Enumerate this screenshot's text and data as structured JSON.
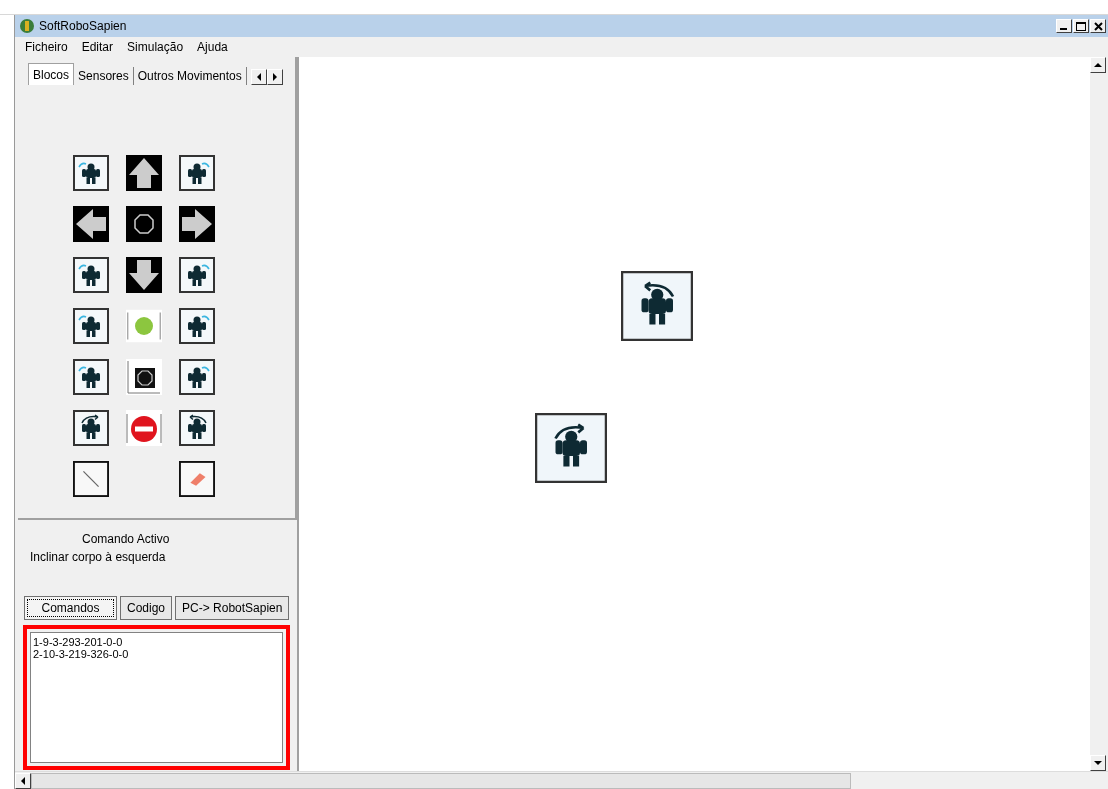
{
  "window": {
    "title": "SoftRoboSapien"
  },
  "menu": [
    "Ficheiro",
    "Editar",
    "Simulação",
    "Ajuda"
  ],
  "palette_tabs": [
    {
      "label": "Blocos",
      "selected": true
    },
    {
      "label": "Sensores",
      "selected": false
    },
    {
      "label": "Outros Movimentos",
      "selected": false
    }
  ],
  "blocks": [
    [
      {
        "kind": "robot"
      },
      {
        "kind": "arrow-up"
      },
      {
        "kind": "robot"
      }
    ],
    [
      {
        "kind": "arrow-left"
      },
      {
        "kind": "stop"
      },
      {
        "kind": "arrow-right"
      }
    ],
    [
      {
        "kind": "robot"
      },
      {
        "kind": "arrow-down"
      },
      {
        "kind": "robot"
      }
    ],
    [
      {
        "kind": "robot"
      },
      {
        "kind": "start"
      },
      {
        "kind": "robot"
      }
    ],
    [
      {
        "kind": "robot"
      },
      {
        "kind": "stop-sign"
      },
      {
        "kind": "robot"
      }
    ],
    [
      {
        "kind": "robot-turn"
      },
      {
        "kind": "no-entry"
      },
      {
        "kind": "robot-turn"
      }
    ],
    [
      {
        "kind": "line"
      },
      {
        "kind": "eraser"
      }
    ]
  ],
  "active_command": {
    "label": "Comando Activo",
    "value": "Inclinar corpo à esquerda"
  },
  "view_buttons": [
    {
      "label": "Comandos",
      "selected": true
    },
    {
      "label": "Codigo",
      "selected": false
    },
    {
      "label": "PC-> RobotSapien",
      "selected": false
    }
  ],
  "command_list": {
    "highlighted": true,
    "lines": [
      "1-9-3-293-201-0-0",
      "2-10-3-219-326-0-0"
    ]
  },
  "canvas_blocks": [
    {
      "kind": "robot-turn-left"
    },
    {
      "kind": "robot-turn-right"
    }
  ]
}
